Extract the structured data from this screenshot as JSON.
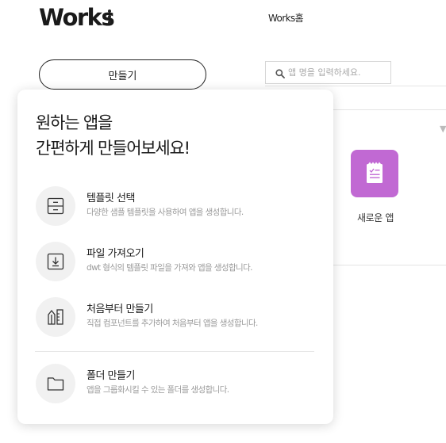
{
  "header": {
    "app_title": "Works",
    "breadcrumb": "Works홈"
  },
  "sidebar": {
    "make_button": "만들기"
  },
  "search": {
    "placeholder": "앱 명을 입력하세요."
  },
  "apps": [
    {
      "label": "새로운 앱",
      "icon": "document-icon",
      "color": "#c169d3"
    }
  ],
  "popup": {
    "title_line1": "원하는 앱을",
    "title_line2": "간편하게 만들어보세요!",
    "options": [
      {
        "title": "템플릿 선택",
        "desc": "다양한 샘플 템플릿을 사용하여 앱을 생성합니다.",
        "icon": "template-icon"
      },
      {
        "title": "파일 가져오기",
        "desc": "dwt 형식의 템플릿 파일을 가져와 앱을 생성합니다.",
        "icon": "import-icon"
      },
      {
        "title": "처음부터 만들기",
        "desc": "직접 컴포넌트를 추가하여 처음부터 앱을 생성합니다.",
        "icon": "build-icon"
      },
      {
        "title": "폴더 만들기",
        "desc": "앱을 그룹화시킬 수 있는 폴더를 생성합니다.",
        "icon": "folder-icon"
      }
    ]
  },
  "colors": {
    "accent": "#c169d3",
    "icon_circle": "#f1f1f1"
  }
}
